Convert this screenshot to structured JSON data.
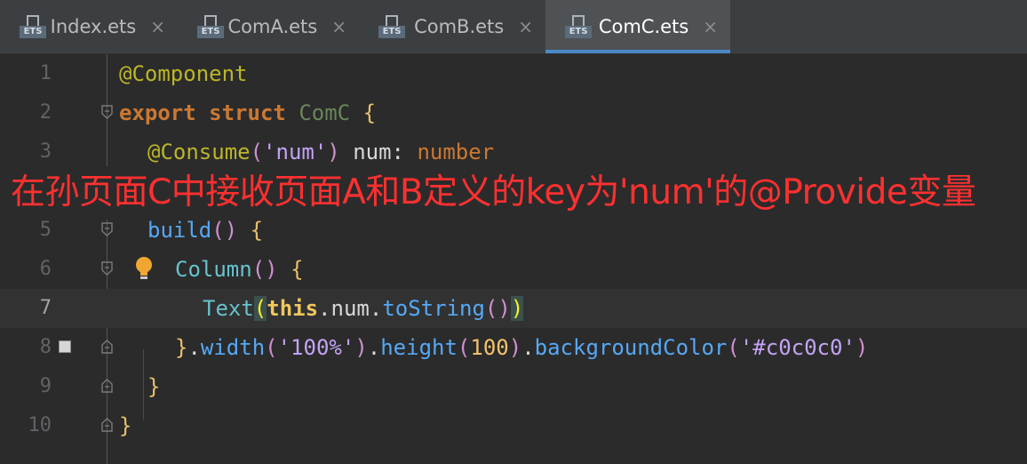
{
  "tabs": [
    {
      "label": "Index.ets",
      "icon": "ets-file-icon",
      "active": false
    },
    {
      "label": "ComA.ets",
      "icon": "ets-file-icon",
      "active": false
    },
    {
      "label": "ComB.ets",
      "icon": "ets-file-icon",
      "active": false
    },
    {
      "label": "ComC.ets",
      "icon": "ets-file-icon",
      "active": true
    }
  ],
  "tab_badge": "ETS",
  "close_glyph": "×",
  "line_numbers": [
    "1",
    "2",
    "3",
    "5",
    "6",
    "7",
    "8",
    "9",
    "10"
  ],
  "code": {
    "l1_ann": "@Component",
    "l2_export": "export",
    "l2_struct": "struct",
    "l2_name": "ComC",
    "l2_brace": "{",
    "l3_ann": "@Consume",
    "l3_p1": "(",
    "l3_str": "'num'",
    "l3_p2": ")",
    "l3_var": " num: ",
    "l3_type": "number",
    "l5_fn": "build",
    "l5_parens": "()",
    "l5_brace": "{",
    "l6_comp": "Column",
    "l6_parens": "()",
    "l6_brace": "{",
    "l7_comp": "Text",
    "l7_p1": "(",
    "l7_this": "this",
    "l7_dot1": ".",
    "l7_num": "num",
    "l7_dot2": ".",
    "l7_fn": "toString",
    "l7_p2": "()",
    "l7_p3": ")",
    "l8_close": "}",
    "l8_dot1": ".",
    "l8_width": "width",
    "l8_p1": "(",
    "l8_str1": "'100%'",
    "l8_p2": ")",
    "l8_dot2": ".",
    "l8_height": "height",
    "l8_p3": "(",
    "l8_n": "100",
    "l8_p4": ")",
    "l8_dot3": ".",
    "l8_bg": "backgroundColor",
    "l8_p5": "(",
    "l8_str2": "'#c0c0c0'",
    "l8_p6": ")",
    "l9_close": "}",
    "l10_close": "}"
  },
  "annotation": "在孙页面C中接收页面A和B定义的key为'num'的@Provide变量",
  "colors": {
    "background": "#2b2b2b",
    "annotation": "#ff3030",
    "active_tab_underline": "#4a88c7"
  }
}
